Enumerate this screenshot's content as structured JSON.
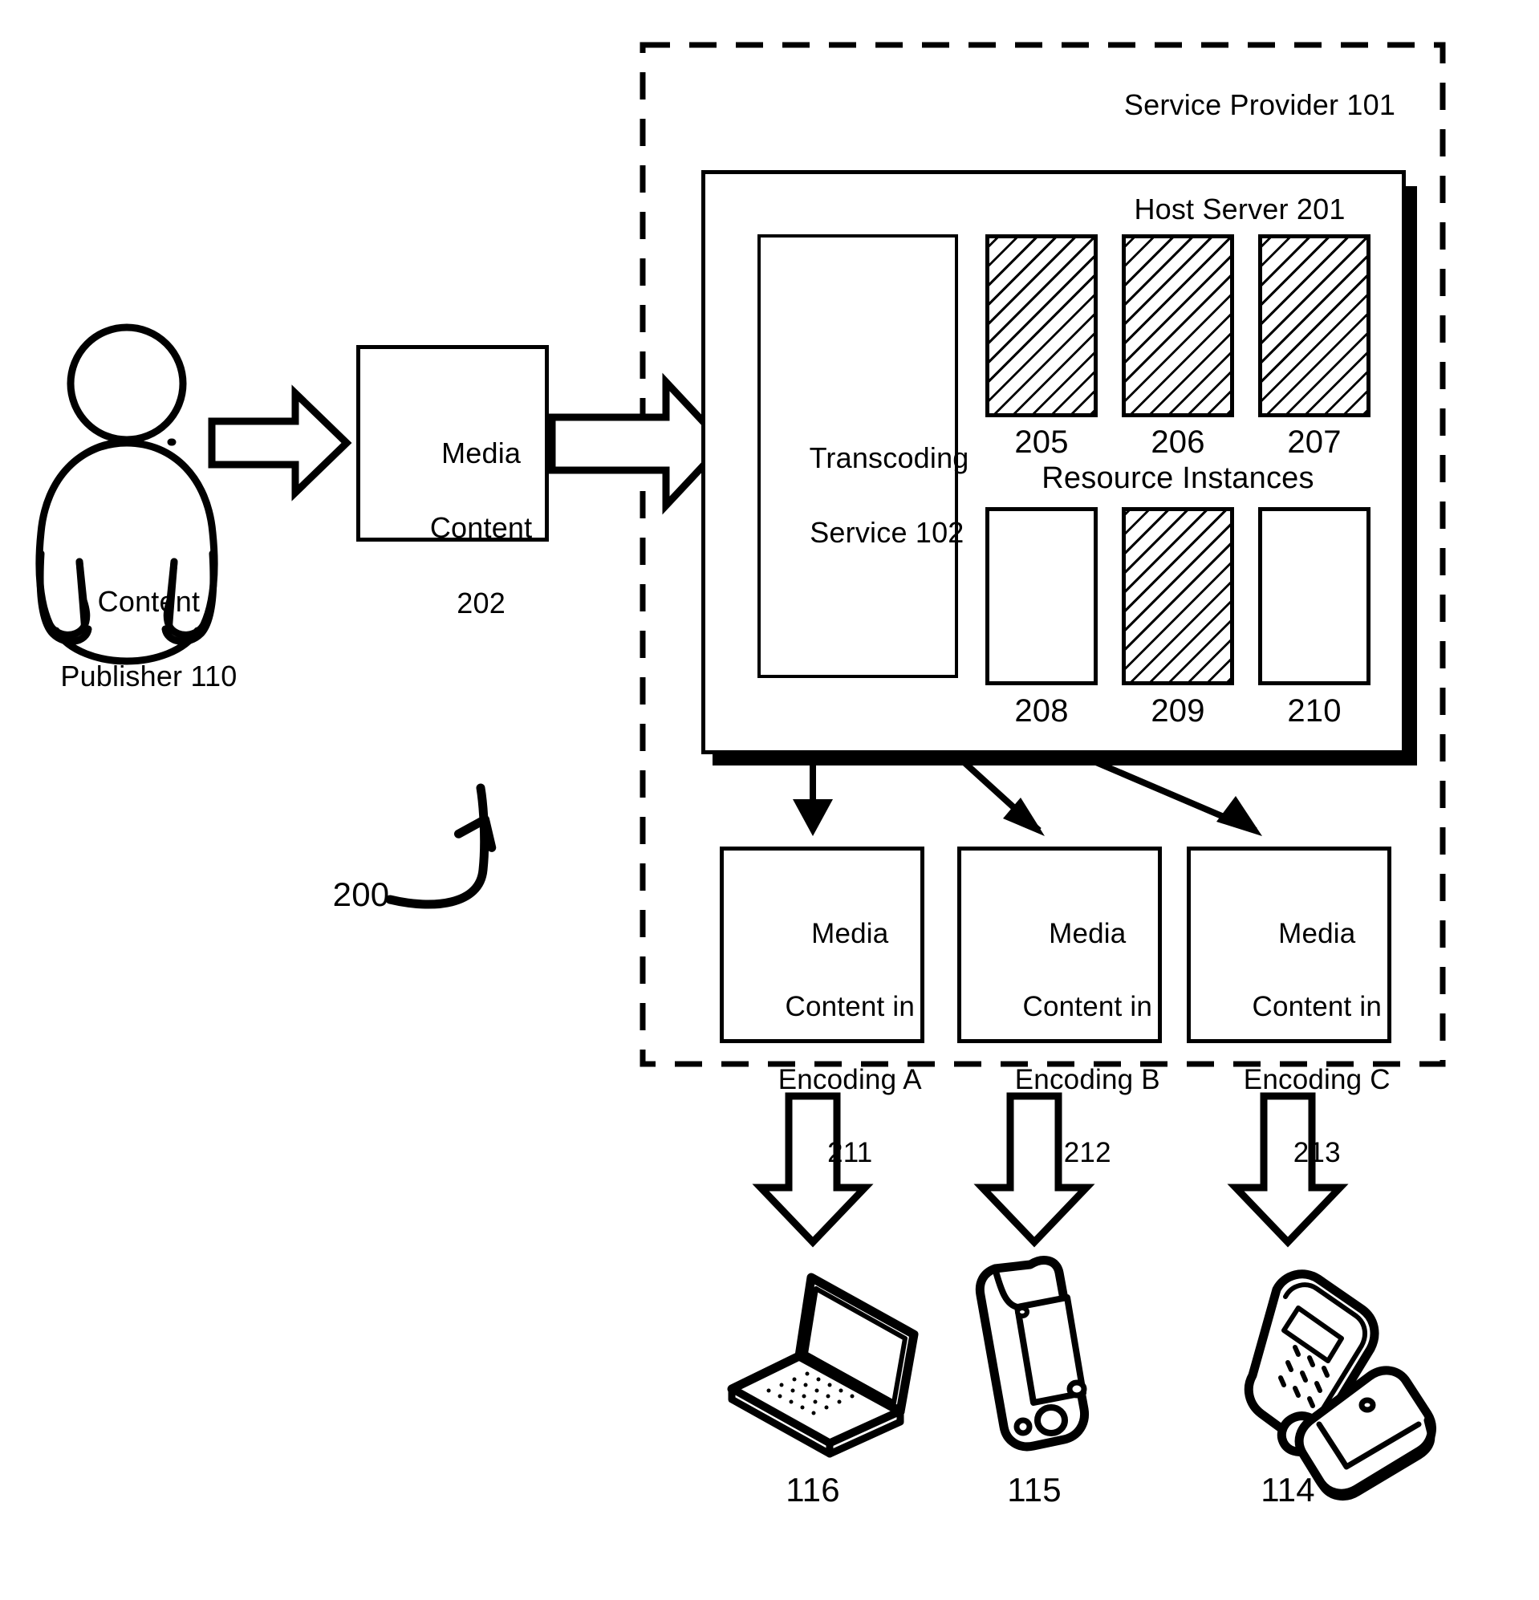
{
  "figure": {
    "reference_number": "200",
    "dashed_boundary_label": "Service Provider 101"
  },
  "actors": {
    "publisher": {
      "icon": "person-icon",
      "label_line1": "Content",
      "label_line2": "Publisher 110"
    }
  },
  "input": {
    "media_content": {
      "line1": "Media",
      "line2": "Content",
      "line3": "202"
    }
  },
  "service_provider": {
    "label": "Service Provider 101",
    "host_server": {
      "label": "Host Server 201",
      "transcoding_service": {
        "line1": "Transcoding",
        "line2": "Service 102"
      },
      "resource_instances_label": "Resource Instances",
      "resource_instances": [
        {
          "id": "205",
          "state": "allocated",
          "hatched": true
        },
        {
          "id": "206",
          "state": "allocated",
          "hatched": true
        },
        {
          "id": "207",
          "state": "allocated",
          "hatched": true
        },
        {
          "id": "208",
          "state": "free",
          "hatched": false
        },
        {
          "id": "209",
          "state": "allocated",
          "hatched": true
        },
        {
          "id": "210",
          "state": "free",
          "hatched": false
        }
      ]
    },
    "outputs": [
      {
        "line1": "Media",
        "line2": "Content in",
        "line3": "Encoding A",
        "line4": "211"
      },
      {
        "line1": "Media",
        "line2": "Content in",
        "line3": "Encoding B",
        "line4": "212"
      },
      {
        "line1": "Media",
        "line2": "Content in",
        "line3": "Encoding C",
        "line4": "213"
      }
    ]
  },
  "devices": [
    {
      "icon": "laptop-icon",
      "label": "116"
    },
    {
      "icon": "pda-icon",
      "label": "115"
    },
    {
      "icon": "flip-phone-icon",
      "label": "114"
    }
  ],
  "colors": {
    "stroke": "#000000",
    "background": "#ffffff"
  }
}
